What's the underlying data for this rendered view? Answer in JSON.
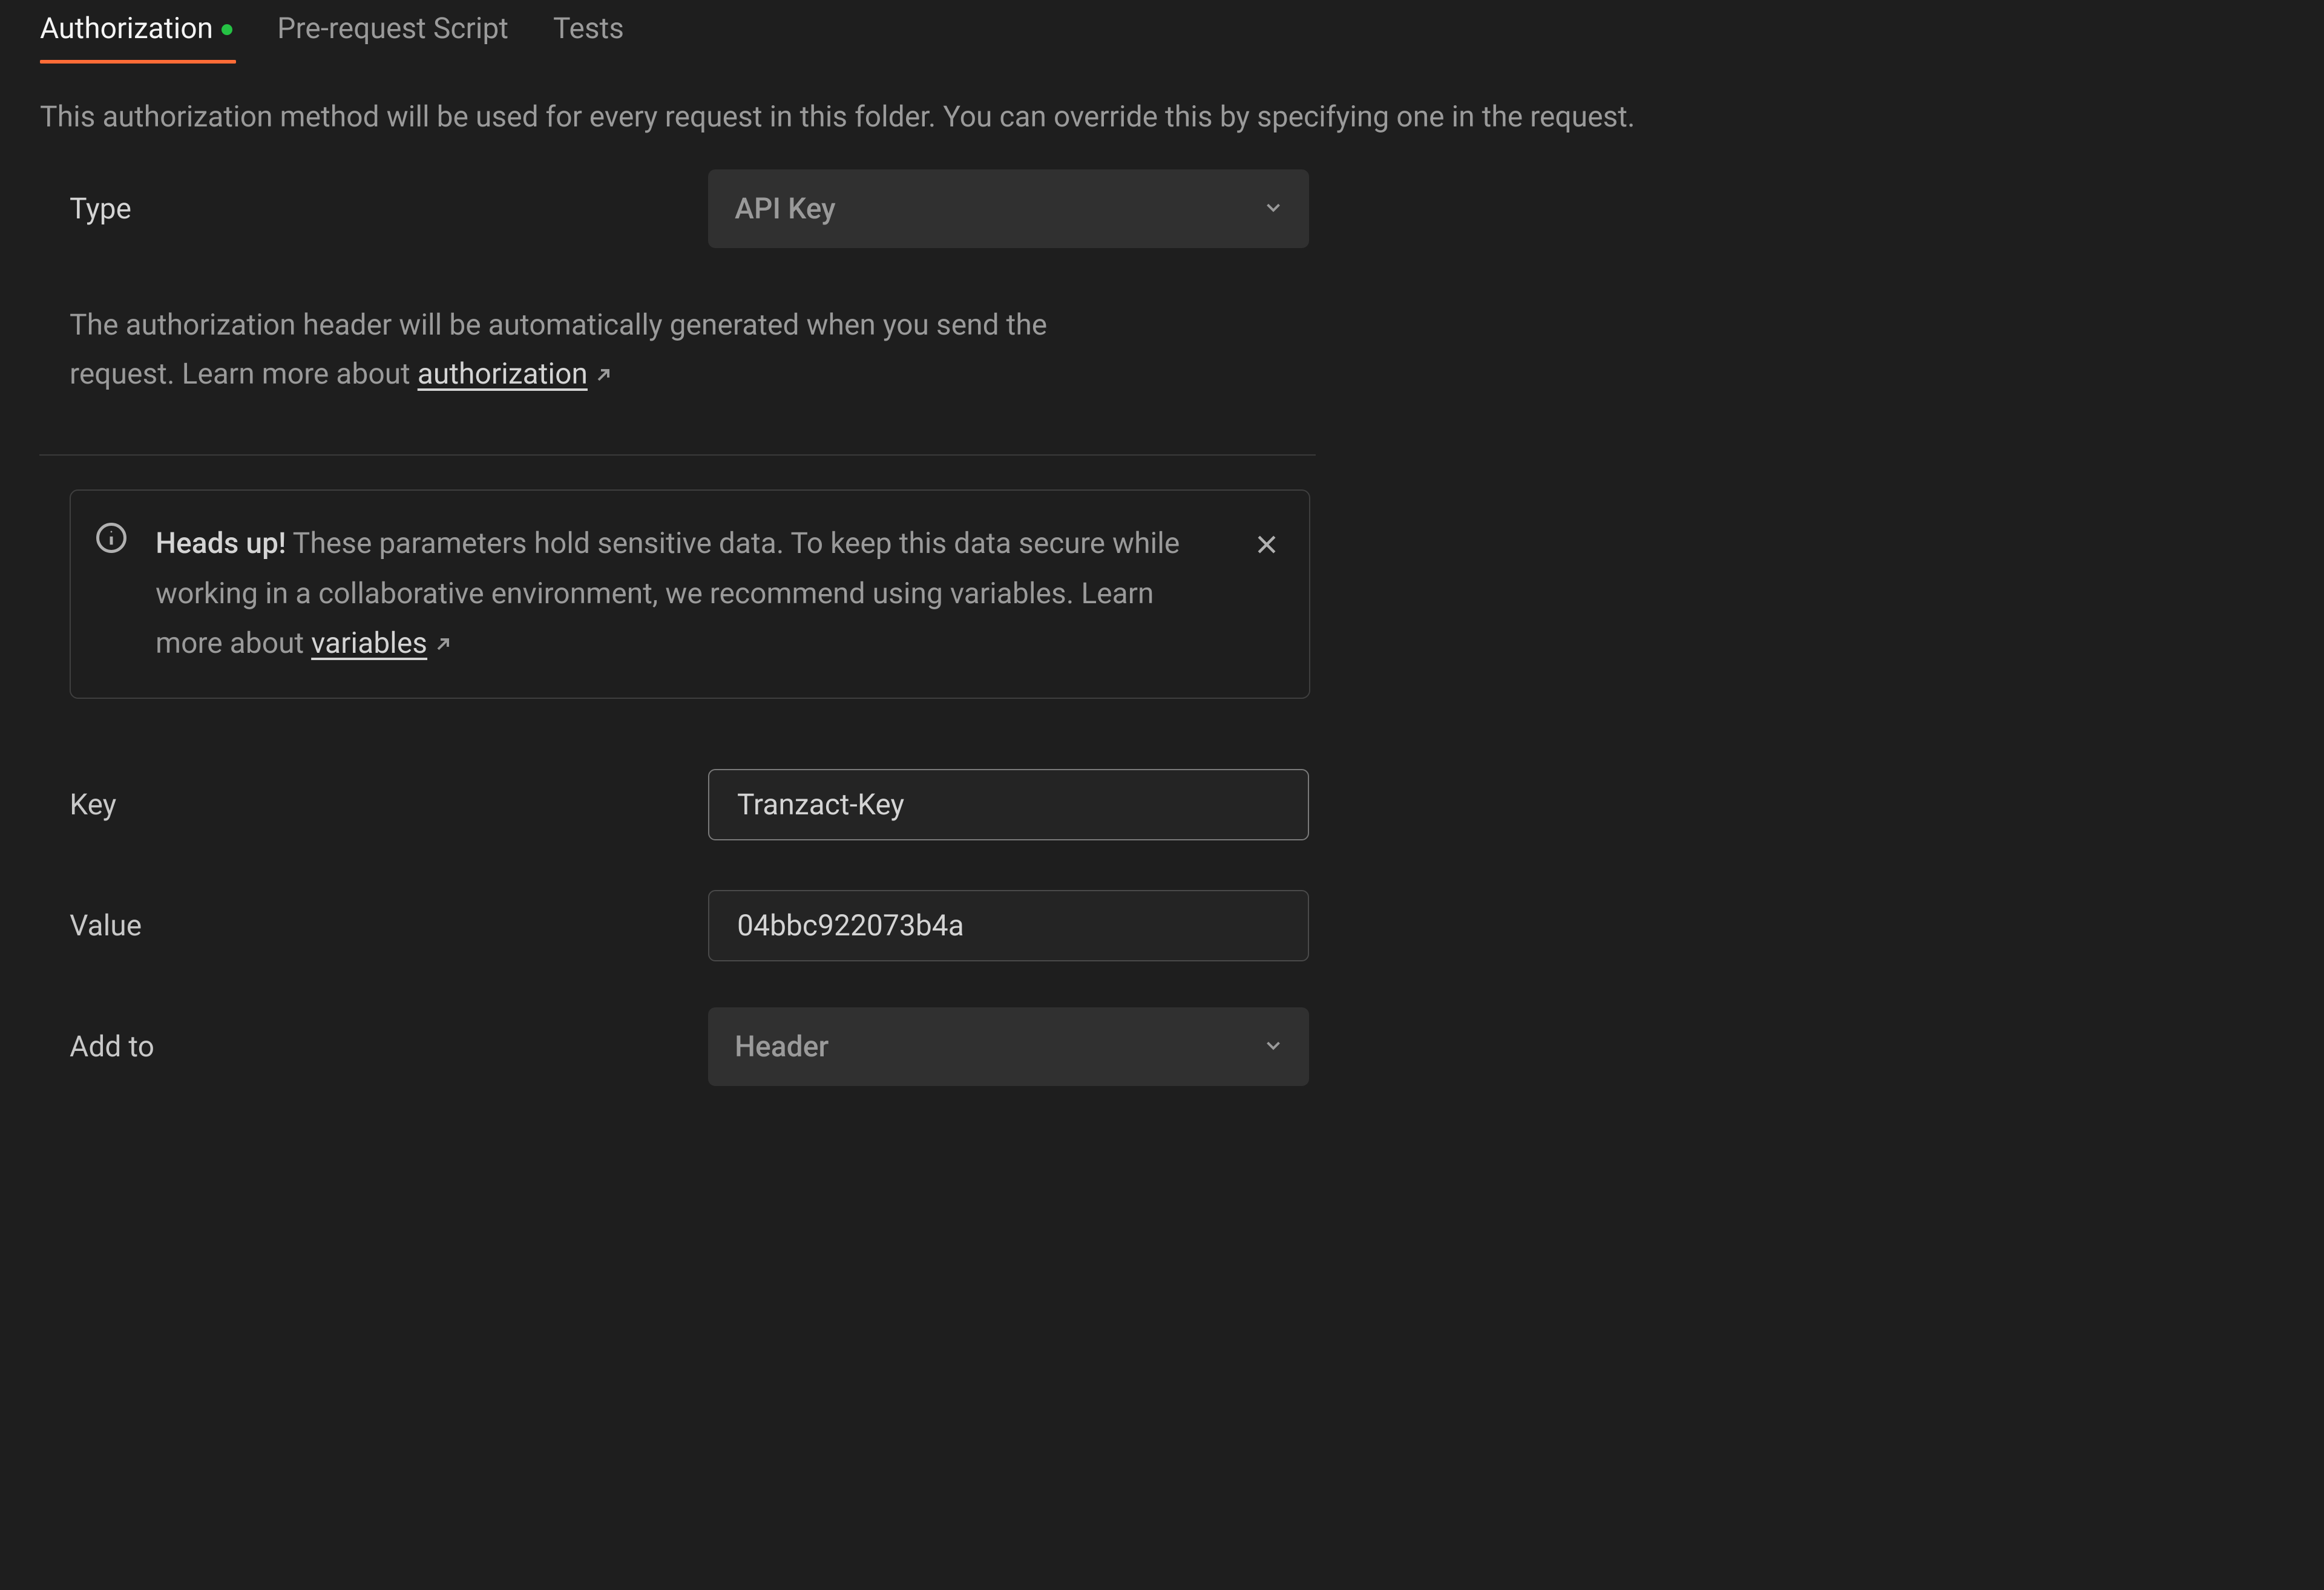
{
  "tabs": {
    "authorization": "Authorization",
    "pre_request": "Pre-request Script",
    "tests": "Tests"
  },
  "description": "This authorization method will be used for every request in this folder. You can override this by specifying one in the request.",
  "type": {
    "label": "Type",
    "value": "API Key"
  },
  "helper": {
    "text_prefix": "The authorization header will be automatically generated when you send the request. Learn more about ",
    "link_label": "authorization"
  },
  "notice": {
    "strong": "Heads up!",
    "body": " These parameters hold sensitive data. To keep this data secure while working in a collaborative environment, we recommend using variables. Learn more about ",
    "link_label": "variables"
  },
  "fields": {
    "key": {
      "label": "Key",
      "value": "Tranzact-Key"
    },
    "value": {
      "label": "Value",
      "value": "04bbc922073b4a"
    },
    "add_to": {
      "label": "Add to",
      "value": "Header"
    }
  }
}
